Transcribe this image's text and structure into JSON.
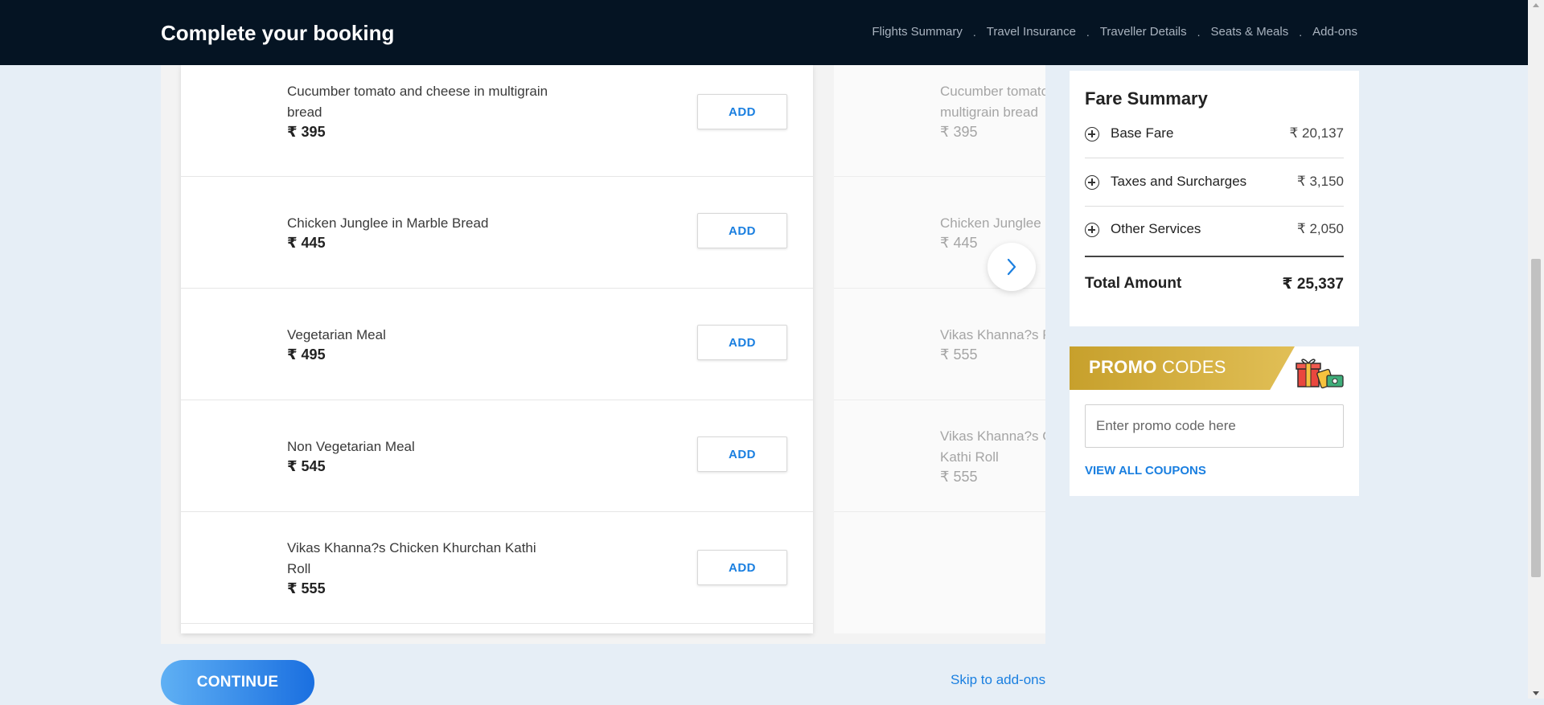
{
  "header": {
    "title": "Complete your booking",
    "steps": [
      "Flights Summary",
      "Travel Insurance",
      "Traveller Details",
      "Seats & Meals",
      "Add-ons"
    ],
    "separator": "."
  },
  "currency": "₹",
  "meals": [
    {
      "name": "Cucumber tomato and cheese in multigrain bread",
      "price": "395",
      "action": "ADD"
    },
    {
      "name": "Chicken Junglee in Marble Bread",
      "price": "445",
      "action": "ADD"
    },
    {
      "name": "Vegetarian Meal",
      "price": "495",
      "action": "ADD"
    },
    {
      "name": "Non Vegetarian Meal",
      "price": "545",
      "action": "ADD"
    },
    {
      "name": "Vikas Khanna?s Chicken Khurchan Kathi Roll",
      "price": "555",
      "action": "ADD"
    }
  ],
  "meals_second_flight": [
    {
      "name": "Cucumber tomato and cheese in multigrain bread",
      "price": "395"
    },
    {
      "name": "Chicken Junglee in Marble Bread",
      "price": "445"
    },
    {
      "name": "Vikas Khanna?s Paneer Kathi Roll",
      "price": "555"
    },
    {
      "name": "Vikas Khanna?s Chicken Khurchan Kathi Roll",
      "price": "555"
    }
  ],
  "fare_summary": {
    "title": "Fare Summary",
    "items": [
      {
        "label": "Base Fare",
        "amount": "₹ 20,137"
      },
      {
        "label": "Taxes and Surcharges",
        "amount": "₹ 3,150"
      },
      {
        "label": "Other Services",
        "amount": "₹ 2,050"
      }
    ],
    "total_label": "Total Amount",
    "total_amount": "₹ 25,337"
  },
  "promo": {
    "title_bold": "PROMO",
    "title_rest": " CODES",
    "placeholder": "Enter promo code here",
    "view_all": "VIEW ALL COUPONS"
  },
  "footer": {
    "continue": "CONTINUE",
    "skip": "Skip to add-ons"
  },
  "colors": {
    "header_bg": "#051423",
    "accent_blue": "#1a7fe0",
    "page_bg": "#e6eef6",
    "promo_gold": "#c7a02c"
  }
}
